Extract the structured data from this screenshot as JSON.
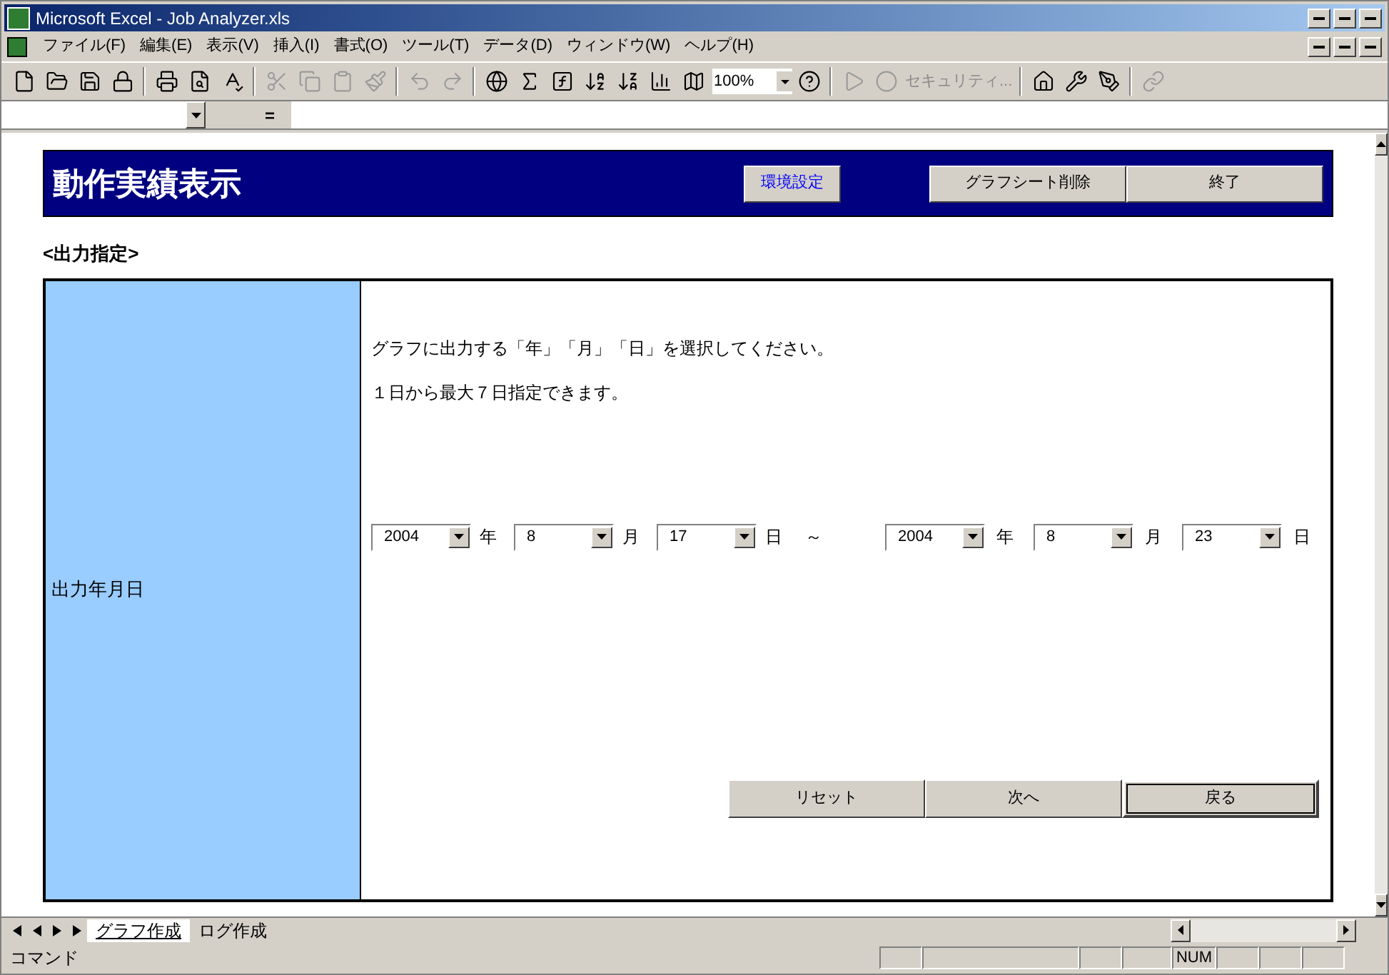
{
  "window": {
    "title": "Microsoft Excel - Job Analyzer.xls"
  },
  "menu": [
    "ファイル(F)",
    "編集(E)",
    "表示(V)",
    "挿入(I)",
    "書式(O)",
    "ツール(T)",
    "データ(D)",
    "ウィンドウ(W)",
    "ヘルプ(H)"
  ],
  "toolbar": {
    "zoom": "100%",
    "security": "セキュリティ..."
  },
  "formula_bar": {
    "equals": "="
  },
  "sheet": {
    "title": "動作実績表示",
    "header_buttons": [
      {
        "label": "環境設定",
        "kind": "link"
      },
      {
        "label": "グラフシート削除",
        "kind": "plain"
      },
      {
        "label": "終了",
        "kind": "plain"
      }
    ],
    "section_label": "<出力指定>",
    "row_label": "出力年月日",
    "instructions": [
      "グラフに出力する「年」「月」「日」を選択してください。",
      "１日から最大７日指定できます。"
    ],
    "from": [
      {
        "value": "2004",
        "unit": "年"
      },
      {
        "value": "8",
        "unit": "月"
      },
      {
        "value": "17",
        "unit": "日"
      }
    ],
    "separator": "～",
    "to": [
      {
        "value": "2004",
        "unit": "年"
      },
      {
        "value": "8",
        "unit": "月"
      },
      {
        "value": "23",
        "unit": "日"
      }
    ],
    "action_buttons": [
      {
        "label": "リセット",
        "selected": false
      },
      {
        "label": "次へ",
        "selected": false
      },
      {
        "label": "戻る",
        "selected": true
      }
    ]
  },
  "sheet_tabs": [
    {
      "label": "グラフ作成",
      "selected": true
    },
    {
      "label": "ログ作成",
      "selected": false
    }
  ],
  "status_bar": {
    "text": "コマンド",
    "indicator": "NUM"
  }
}
